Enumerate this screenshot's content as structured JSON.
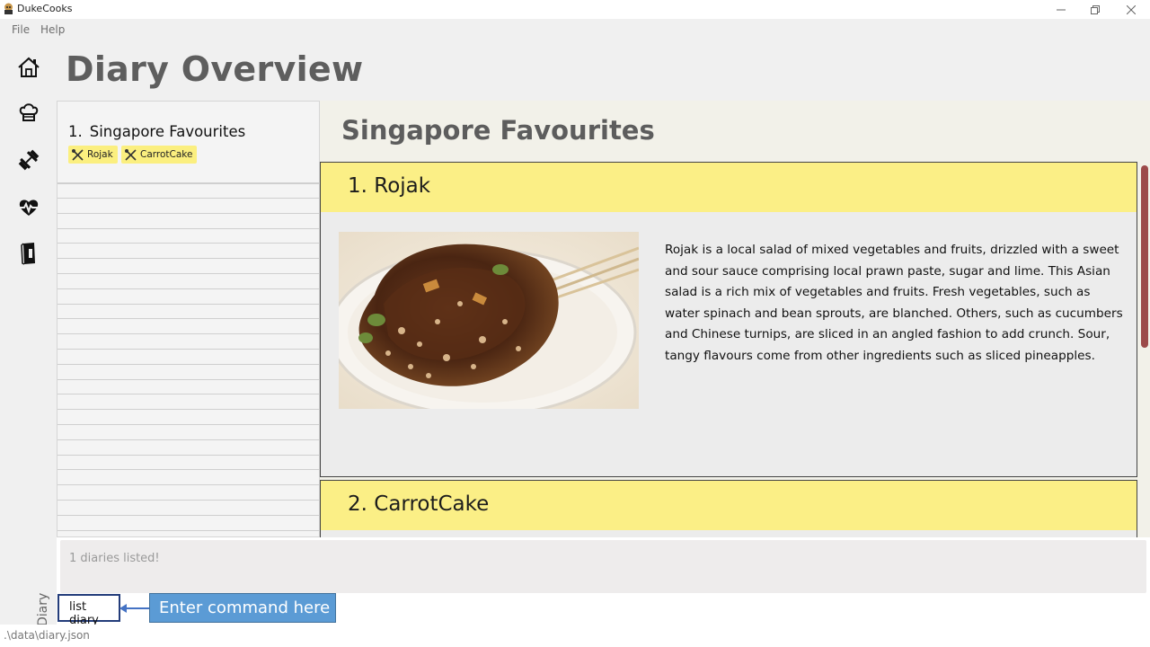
{
  "window": {
    "title": "DukeCooks"
  },
  "menu": {
    "file": "File",
    "help": "Help"
  },
  "sidebar": {
    "items": [
      {
        "name": "home",
        "icon": "home-icon"
      },
      {
        "name": "recipes",
        "icon": "chef-hat-icon"
      },
      {
        "name": "exercise",
        "icon": "dumbbell-icon"
      },
      {
        "name": "health",
        "icon": "heartbeat-icon"
      },
      {
        "name": "diary",
        "icon": "book-icon"
      }
    ],
    "vertical_label": "Diary"
  },
  "page": {
    "title": "Diary Overview"
  },
  "diary_list": {
    "items": [
      {
        "index": "1.",
        "name": "Singapore Favourites",
        "tags": [
          "Rojak",
          "CarrotCake"
        ]
      }
    ]
  },
  "detail": {
    "title": "Singapore Favourites",
    "pages": [
      {
        "title": "1. Rojak",
        "description": "Rojak is a local salad of mixed vegetables and fruits, drizzled with a sweet and sour sauce comprising local prawn paste, sugar and lime. This Asian salad is a rich mix of vegetables and fruits. Fresh vegetables, such as water spinach and bean sprouts, are blanched. Others, such as cucumbers and Chinese turnips, are sliced in an angled fashion to add crunch. Sour, tangy flavours come from other ingredients such as sliced pineapples."
      },
      {
        "title": "2. CarrotCake"
      }
    ]
  },
  "result": {
    "text": "1 diaries listed!"
  },
  "command": {
    "value": "list diary",
    "callout": "Enter command here"
  },
  "status": {
    "path": ".\\data\\diary.json"
  },
  "colors": {
    "tag": "#fbef7f",
    "card_header": "#fbef86",
    "scroll_thumb": "#9c4a4a",
    "callout": "#5b9bd5"
  }
}
